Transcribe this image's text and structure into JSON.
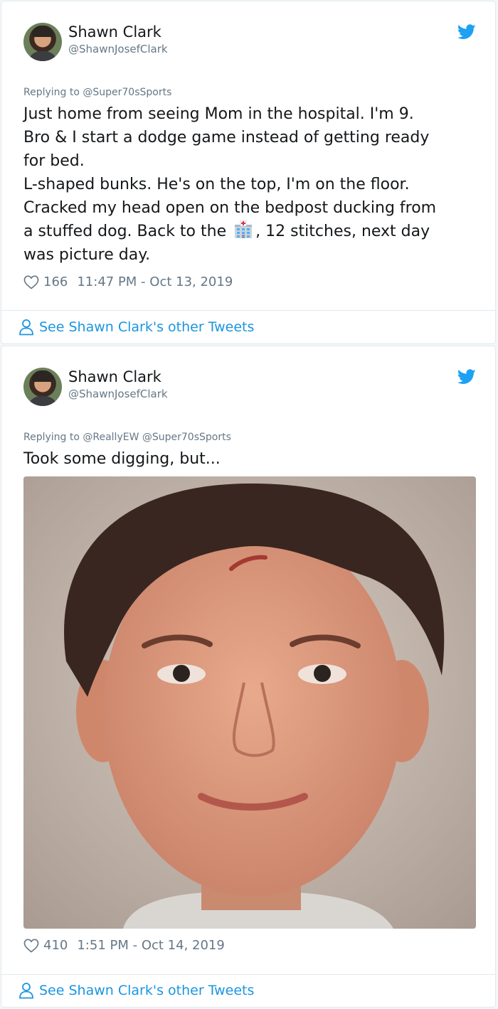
{
  "tweets": [
    {
      "name": "Shawn Clark",
      "handle": "@ShawnJosefClark",
      "replying_to": "Replying to @Super70sSports",
      "text_lines": [
        "Just home from seeing Mom in the hospital. I'm 9.",
        "Bro & I start a dodge game instead of getting ready",
        "for bed.",
        "L-shaped bunks. He's on the top, I'm on the floor.",
        "Cracked my head open on the bedpost ducking from",
        "a stuffed dog. Back to the",
        ", 12 stitches, next day",
        "was picture day."
      ],
      "emoji": "hospital-emoji",
      "likes": "166",
      "timestamp": "11:47 PM - Oct 13, 2019",
      "more_link": "See Shawn Clark's other Tweets"
    },
    {
      "name": "Shawn Clark",
      "handle": "@ShawnJosefClark",
      "replying_to": "Replying to @ReallyEW @Super70sSports",
      "text": "Took some digging, but...",
      "photo": "school-portrait-photo",
      "likes": "410",
      "timestamp": "1:51 PM - Oct 14, 2019",
      "more_link": "See Shawn Clark's other Tweets"
    }
  ],
  "colors": {
    "link": "#1b95e0",
    "twitter_blue": "#1da1f2",
    "meta": "#657786",
    "text": "#14171a",
    "border": "#e1e8ed"
  }
}
